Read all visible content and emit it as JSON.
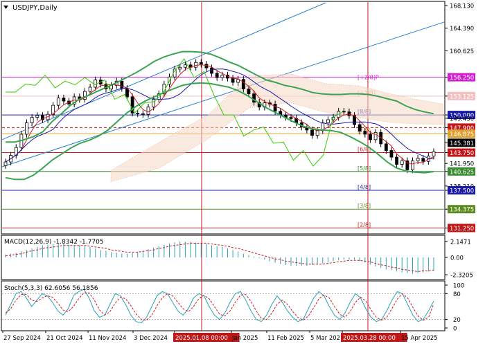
{
  "symbol_title": "USDJPY,Daily",
  "macd_label": "MACD(12,26,9) -1.8342 -1.7705",
  "stoch_label": "Stoch(5,3,3) 62.6056 56.1856",
  "colors": {
    "up_candle": "#000000",
    "down_candle": "#000000",
    "bollinger": "#3aa352",
    "ma_fast": "#d11a1a",
    "ma_slow": "#1a1aa8",
    "chikou": "#33cc00",
    "cloud": "#e8a070",
    "channel": "#2a7fd0",
    "marker_line": "#c01818",
    "macd_hist": "#2aa0b8",
    "macd_signal": "#d11a1a",
    "stoch_main": "#2aa0b8",
    "stoch_signal": "#d11a1a"
  },
  "chart_data": [
    {
      "type": "line",
      "panel": "price",
      "title": "USDJPY,Daily",
      "x_tick_labels": [
        "27 Sep 2024",
        "21 Oct 2024",
        "11 Nov 2024",
        "3 Dec 2024",
        "2025.01.08 00:00",
        "Jan 2025",
        "11 Feb 2025",
        "5 Mar 202",
        "2025.03.28 00:00",
        "15 Apr 2025"
      ],
      "y_tick_labels": [
        "168.130",
        "164.390",
        "160.625",
        "156.250",
        "153.125",
        "150.000",
        "149.450",
        "147.900",
        "146.875",
        "145.381",
        "143.750",
        "141.950",
        "140.625",
        "138.210",
        "137.500",
        "134.375",
        "131.250"
      ],
      "ylim": [
        130.5,
        168.6
      ],
      "close_series": [
        142.2,
        143.3,
        144.6,
        146.8,
        148.7,
        149.6,
        149.9,
        149.2,
        150.1,
        151.6,
        152.8,
        152.3,
        151.8,
        153.0,
        152.6,
        153.9,
        154.6,
        155.8,
        155.1,
        154.3,
        154.9,
        155.6,
        154.4,
        153.0,
        150.3,
        150.2,
        150.1,
        151.3,
        152.6,
        153.5,
        155.1,
        156.3,
        157.6,
        157.9,
        158.3,
        157.9,
        158.7,
        158.4,
        157.8,
        156.9,
        156.2,
        156.6,
        156.1,
        155.4,
        155.9,
        154.3,
        153.5,
        152.1,
        151.3,
        152.0,
        151.8,
        150.6,
        150.0,
        149.6,
        149.4,
        148.7,
        148.0,
        147.5,
        146.6,
        147.4,
        148.7,
        149.2,
        149.6,
        150.6,
        150.5,
        149.9,
        148.4,
        147.3,
        146.8,
        145.9,
        147.1,
        145.2,
        144.1,
        143.0,
        141.8,
        142.4,
        140.9,
        142.4,
        142.8,
        142.3,
        143.2,
        143.9
      ],
      "series": [
        {
          "style": "bollinger",
          "values_upper": [
            145.5,
            145.5,
            145.9,
            146.4,
            147.2,
            148.9,
            150.2,
            151.6,
            152.7,
            153.3,
            154.0,
            154.7,
            155.4,
            156.2,
            157.0,
            157.9,
            158.9,
            159.6,
            160.1,
            160.5,
            160.5,
            160.4,
            160.1,
            159.5,
            158.8,
            158.2,
            157.4,
            156.6,
            155.8,
            155.4,
            154.9,
            154.6,
            154.2,
            153.7,
            153.5,
            153.4,
            153.4,
            153.5,
            153.5,
            153.4,
            153.1,
            152.7,
            152.3,
            151.5,
            150.9,
            150.5,
            150.2
          ],
          "values_lower": [
            139.6,
            139.3,
            139.3,
            140.0,
            141.2,
            142.5,
            143.5,
            144.5,
            145.3,
            145.8,
            146.5,
            147.5,
            148.9,
            150.3,
            151.4,
            152.3,
            153.0,
            153.7,
            154.3,
            154.9,
            155.2,
            155.3,
            155.2,
            154.9,
            154.6,
            154.0,
            153.2,
            152.2,
            151.2,
            150.4,
            149.6,
            148.8,
            148.1,
            147.7,
            147.5,
            147.4,
            147.1,
            146.4,
            145.6,
            144.7,
            143.5,
            142.2,
            141.2,
            140.7,
            140.5,
            140.4,
            140.6
          ]
        },
        {
          "name": "",
          "style": "chikou",
          "values": [
            153.8,
            153.8,
            155.1,
            154.9,
            156.6,
            154.5,
            155.6,
            155.0,
            156.2,
            155.0,
            155.8,
            152.6,
            153.4,
            150.3,
            152.0,
            152.2,
            154.0,
            157.2,
            159.3,
            156.2,
            157.2,
            153.3,
            150.0,
            150.0,
            146.5,
            147.5,
            148.0,
            145.3,
            145.5,
            142.5,
            144.1,
            141.5,
            143.3,
            149.6,
            150.5
          ]
        }
      ]
    },
    {
      "type": "bar",
      "panel": "macd",
      "title": "MACD(12,26,9) -1.8342 -1.7705",
      "y_tick_labels": [
        "2.1471",
        "0.00",
        "-2.3205"
      ],
      "ylim": [
        -2.6,
        2.5
      ],
      "values": [
        0.4,
        0.5,
        0.6,
        0.8,
        1.0,
        1.2,
        1.4,
        1.6,
        1.7,
        1.8,
        1.8,
        1.8,
        1.7,
        1.6,
        1.6,
        1.5,
        1.4,
        1.2,
        1.0,
        0.9,
        0.7,
        0.6,
        0.5,
        0.5,
        0.6,
        0.7,
        0.9,
        1.1,
        1.3,
        1.5,
        1.7,
        1.9,
        2.0,
        2.1,
        2.1,
        2.1,
        2.0,
        1.9,
        1.8,
        1.6,
        1.5,
        1.4,
        1.2,
        1.0,
        0.8,
        0.5,
        0.3,
        0.1,
        -0.1,
        -0.3,
        -0.5,
        -0.7,
        -0.9,
        -1.0,
        -1.1,
        -1.1,
        -1.1,
        -1.1,
        -1.0,
        -0.9,
        -0.8,
        -0.7,
        -0.5,
        -0.4,
        -0.3,
        -0.3,
        -0.3,
        -0.5,
        -0.7,
        -1.0,
        -1.2,
        -1.4,
        -1.6,
        -1.7,
        -1.9,
        -2.0,
        -2.1,
        -2.2,
        -2.1,
        -2.0,
        -1.9,
        -1.8
      ],
      "signal": [
        0.2,
        0.3,
        0.4,
        0.5,
        0.7,
        0.9,
        1.0,
        1.2,
        1.3,
        1.4,
        1.5,
        1.6,
        1.6,
        1.6,
        1.6,
        1.6,
        1.5,
        1.4,
        1.3,
        1.2,
        1.0,
        0.9,
        0.8,
        0.7,
        0.7,
        0.7,
        0.8,
        0.9,
        1.0,
        1.2,
        1.3,
        1.5,
        1.6,
        1.7,
        1.8,
        1.9,
        1.9,
        1.9,
        1.9,
        1.8,
        1.7,
        1.6,
        1.5,
        1.3,
        1.2,
        1.0,
        0.8,
        0.6,
        0.4,
        0.2,
        0.0,
        -0.2,
        -0.3,
        -0.5,
        -0.6,
        -0.7,
        -0.8,
        -0.9,
        -0.9,
        -0.9,
        -0.9,
        -0.8,
        -0.7,
        -0.6,
        -0.5,
        -0.4,
        -0.4,
        -0.4,
        -0.5,
        -0.6,
        -0.8,
        -1.0,
        -1.1,
        -1.3,
        -1.4,
        -1.6,
        -1.7,
        -1.8,
        -1.9,
        -1.8,
        -1.8,
        -1.7
      ]
    },
    {
      "type": "line",
      "panel": "stochastic",
      "title": "Stoch(5,3,3) 62.6056 56.1856",
      "y_tick_labels": [
        "100",
        "80",
        "20",
        "0"
      ],
      "ylim": [
        0,
        100
      ],
      "series": [
        {
          "style": "stoch_main",
          "values": [
            30,
            55,
            80,
            85,
            70,
            50,
            65,
            80,
            75,
            60,
            40,
            30,
            45,
            75,
            85,
            90,
            70,
            40,
            25,
            30,
            55,
            80,
            75,
            55,
            30,
            15,
            12,
            25,
            50,
            75,
            85,
            80,
            60,
            40,
            30,
            45,
            70,
            80,
            75,
            50,
            30,
            20,
            35,
            60,
            80,
            85,
            65,
            40,
            20,
            15,
            30,
            55,
            75,
            60,
            40,
            25,
            15,
            20,
            45,
            70,
            85,
            75,
            50,
            30,
            20,
            35,
            60,
            80,
            70,
            45,
            25,
            15,
            20,
            40,
            65,
            85,
            80,
            55,
            30,
            15,
            20,
            40,
            62.6
          ]
        },
        {
          "style": "stoch_signal",
          "values": [
            35,
            45,
            65,
            78,
            78,
            65,
            62,
            70,
            75,
            72,
            58,
            42,
            38,
            50,
            68,
            82,
            82,
            65,
            42,
            30,
            38,
            58,
            72,
            68,
            52,
            33,
            20,
            18,
            30,
            52,
            70,
            80,
            75,
            60,
            45,
            38,
            50,
            68,
            76,
            68,
            50,
            32,
            28,
            40,
            60,
            77,
            78,
            62,
            40,
            22,
            20,
            35,
            55,
            65,
            55,
            38,
            25,
            18,
            28,
            47,
            68,
            77,
            70,
            50,
            32,
            25,
            38,
            60,
            72,
            63,
            42,
            25,
            18,
            25,
            45,
            67,
            80,
            70,
            48,
            28,
            18,
            25,
            56.2
          ]
        }
      ]
    }
  ]
}
